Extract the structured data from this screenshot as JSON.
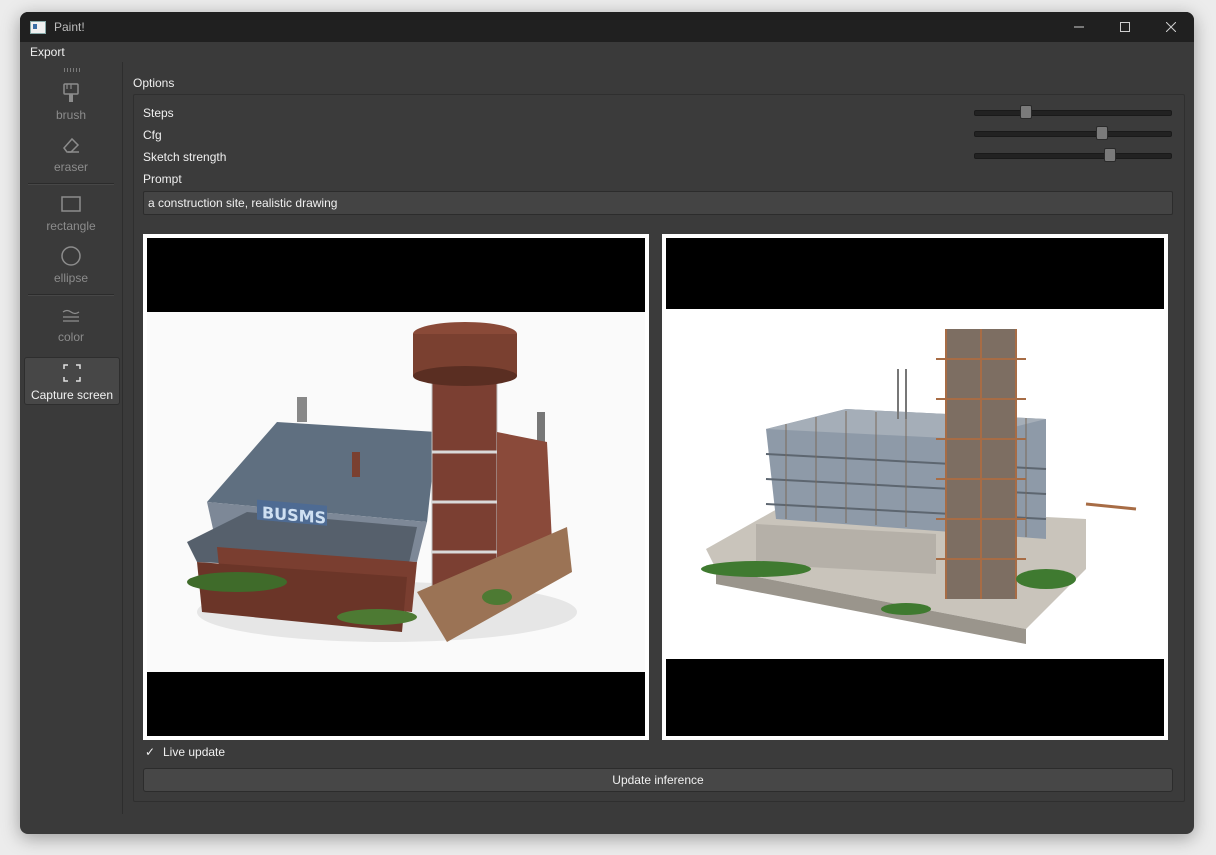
{
  "window": {
    "title": "Paint!",
    "controls": [
      "minimize",
      "maximize",
      "close"
    ]
  },
  "menu": {
    "export_label": "Export"
  },
  "toolbar": {
    "tools": [
      {
        "label": "brush",
        "icon": "brush-icon",
        "active": false
      },
      {
        "label": "eraser",
        "icon": "eraser-icon",
        "active": false
      },
      {
        "label": "rectangle",
        "icon": "rectangle-icon",
        "active": false
      },
      {
        "label": "ellipse",
        "icon": "ellipse-icon",
        "active": false
      },
      {
        "label": "color",
        "icon": "color-icon",
        "active": false
      },
      {
        "label": "Capture screen",
        "icon": "capture-screen-icon",
        "active": true
      }
    ]
  },
  "options": {
    "title": "Options",
    "steps_label": "Steps",
    "steps_value": 0.26,
    "cfg_label": "Cfg",
    "cfg_value": 0.64,
    "sketch_label": "Sketch strength",
    "sketch_value": 0.68,
    "prompt_label": "Prompt",
    "prompt_value": "a construction site, realistic drawing",
    "live_update_label": "Live update",
    "live_update_checked": true,
    "update_button_label": "Update inference"
  },
  "images": {
    "input": "photo of old brick building with water tower",
    "output": "rendering of construction site with scaffolding tower"
  },
  "colors": {
    "window_bg": "#3a3a3a",
    "titlebar_bg": "#202020",
    "text": "#f0f0f0",
    "muted": "#8c8c8c"
  }
}
